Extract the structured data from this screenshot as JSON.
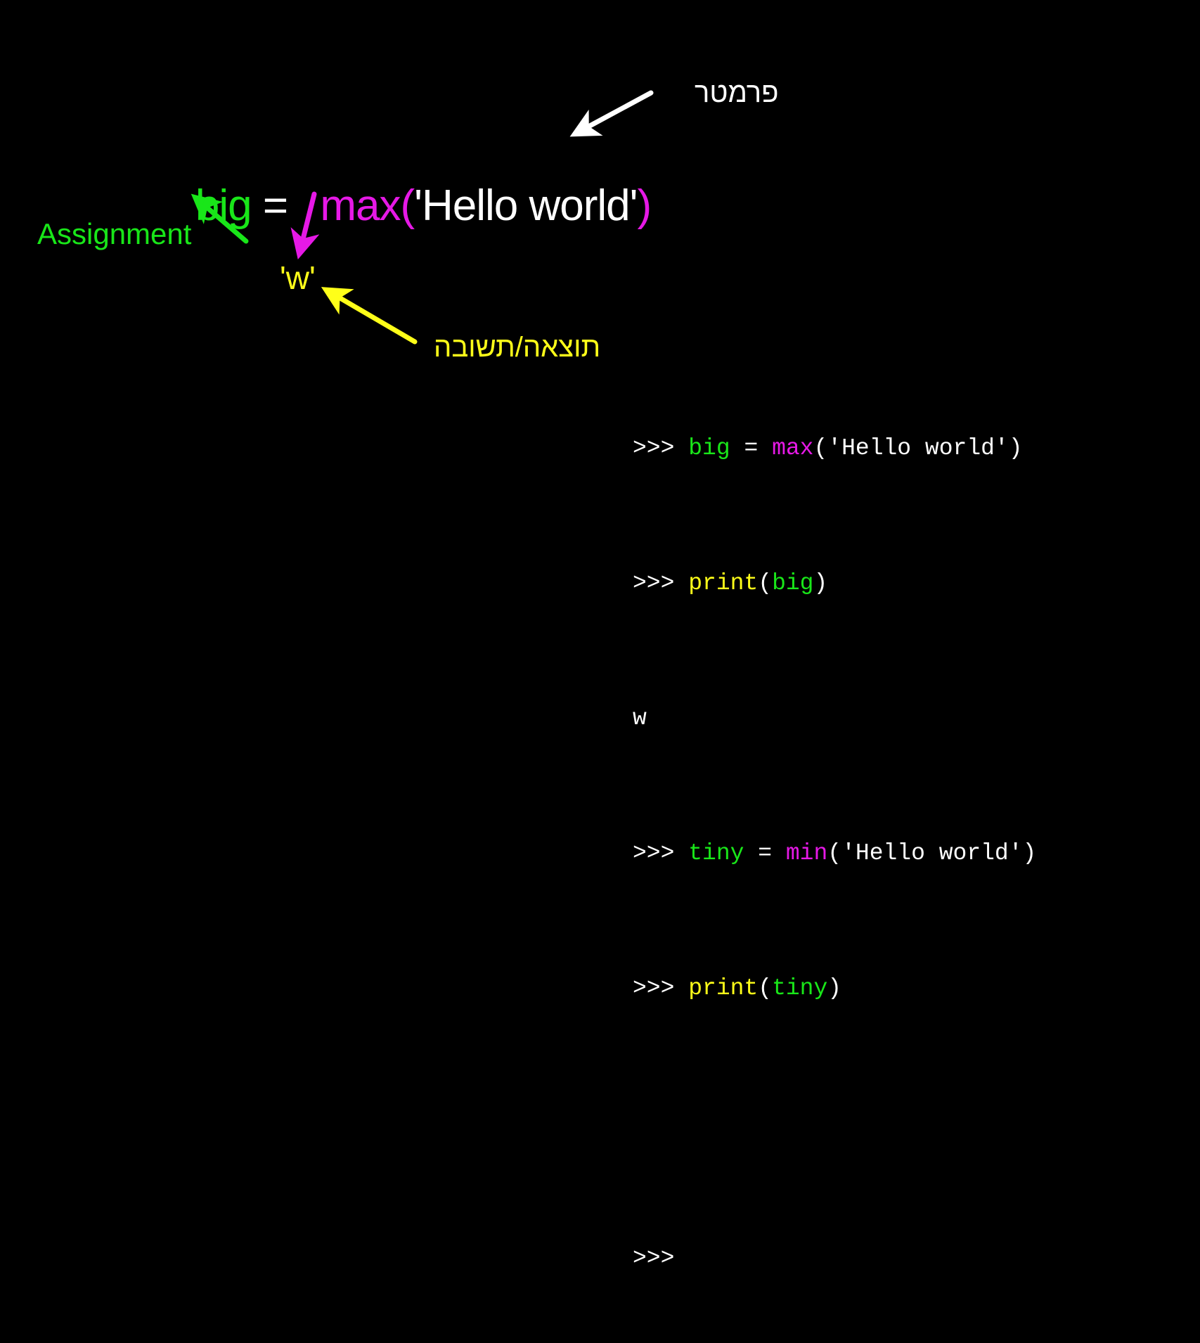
{
  "colors": {
    "background": "#000000",
    "variable": "#19e619",
    "function": "#e619e6",
    "text": "#ffffff",
    "result": "#ffff19"
  },
  "expression": {
    "var": "big",
    "eq": " = ",
    "func": "max",
    "open_paren": "(",
    "arg": "'Hello world'",
    "close_paren": ")"
  },
  "labels": {
    "parameter": "פרמטר",
    "assignment": "Assignment",
    "result_value": "'w'",
    "result_answer": "תוצאה/תשובה"
  },
  "console": {
    "prompt": ">>> ",
    "lines": [
      {
        "prompt": ">>> ",
        "var": "big",
        "eq": " = ",
        "func": "max",
        "rest": "('Hello world')"
      },
      {
        "prompt": ">>> ",
        "print": "print",
        "open": "(",
        "var": "big",
        "close": ")"
      },
      {
        "output": "w"
      },
      {
        "prompt": ">>> ",
        "var": "tiny",
        "eq": " = ",
        "func": "min",
        "rest": "('Hello world')"
      },
      {
        "prompt": ">>> ",
        "print": "print",
        "open": "(",
        "var": "tiny",
        "close": ")"
      },
      {
        "output": ""
      },
      {
        "prompt": ">>>"
      }
    ]
  },
  "icons": {
    "param_arrow": "arrow-icon",
    "assign_arrow": "arrow-icon",
    "call_arrow": "arrow-icon",
    "result_arrow": "arrow-icon"
  }
}
